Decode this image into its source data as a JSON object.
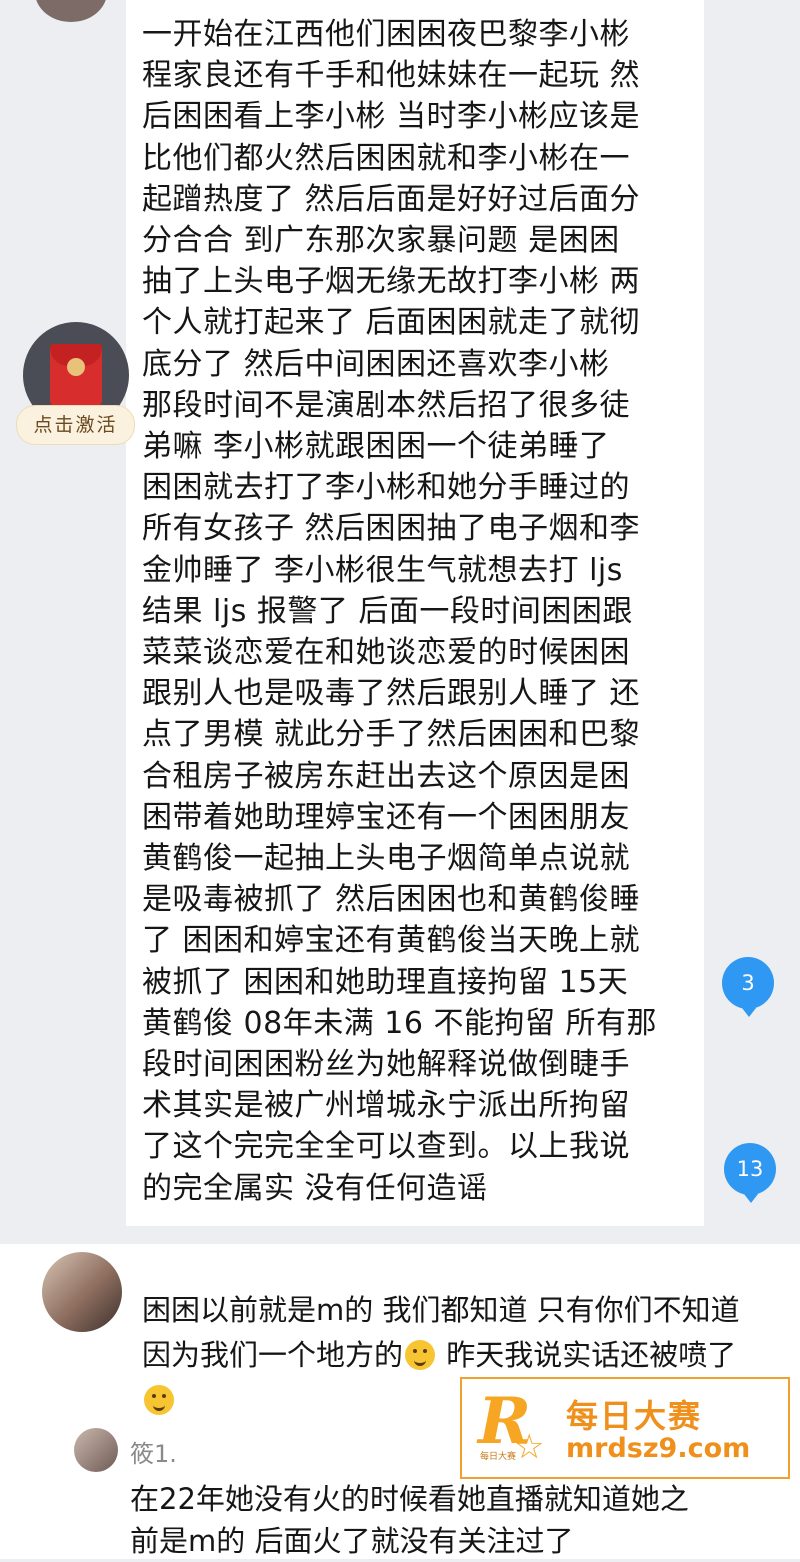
{
  "chat": {
    "message_text": "一开始在江西他们困困夜巴黎李小彬\n程家良还有千手和他妹妹在一起玩 然\n后困困看上李小彬 当时李小彬应该是\n比他们都火然后困困就和李小彬在一\n起蹭热度了 然后后面是好好过后面分\n分合合 到广东那次家暴问题 是困困\n抽了上头电子烟无缘无故打李小彬 两\n个人就打起来了 后面困困就走了就彻\n底分了 然后中间困困还喜欢李小彬\n那段时间不是演剧本然后招了很多徒\n弟嘛 李小彬就跟困困一个徒弟睡了\n困困就去打了李小彬和她分手睡过的\n所有女孩子 然后困困抽了电子烟和李\n金帅睡了 李小彬很生气就想去打 ljs\n结果 ljs 报警了 后面一段时间困困跟\n菜菜谈恋爱在和她谈恋爱的时候困困\n跟别人也是吸毒了然后跟别人睡了 还\n点了男模 就此分手了然后困困和巴黎\n合租房子被房东赶出去这个原因是困\n困带着她助理婷宝还有一个困困朋友\n黄鹤俊一起抽上头电子烟简单点说就\n是吸毒被抓了 然后困困也和黄鹤俊睡\n了 困困和婷宝还有黄鹤俊当天晚上就\n被抓了 困困和她助理直接拘留 15天\n黄鹤俊 08年未满 16 不能拘留 所有那\n段时间困困粉丝为她解释说做倒睫手\n术其实是被广州增城永宁派出所拘留\n了这个完完全全可以查到。以上我说\n的完全属实 没有任何造谣",
    "activate_label": "点击激活",
    "counts": [
      "3",
      "13"
    ]
  },
  "comments": [
    {
      "text_part1": "困困以前就是m的 我们都知道 只有你们不知道 因为我们一个地方的",
      "text_part2": " 昨天我说实话还被喷了",
      "emojis": [
        "laughing-emoji",
        "awkward-smile-emoji"
      ]
    },
    {
      "username": "筱1.",
      "text": "在22年她没有火的时候看她直播就知道她之前是m的 后面火了就没有关注过了"
    }
  ],
  "watermark": {
    "logo_letter": "R",
    "logo_small": "每日大赛",
    "title": "每日大赛",
    "url": "mrdsz9.com"
  },
  "colors": {
    "background": "#eceef1",
    "bubble": "#ffffff",
    "count_badge": "#2f98f2",
    "watermark": "#f0901c"
  }
}
